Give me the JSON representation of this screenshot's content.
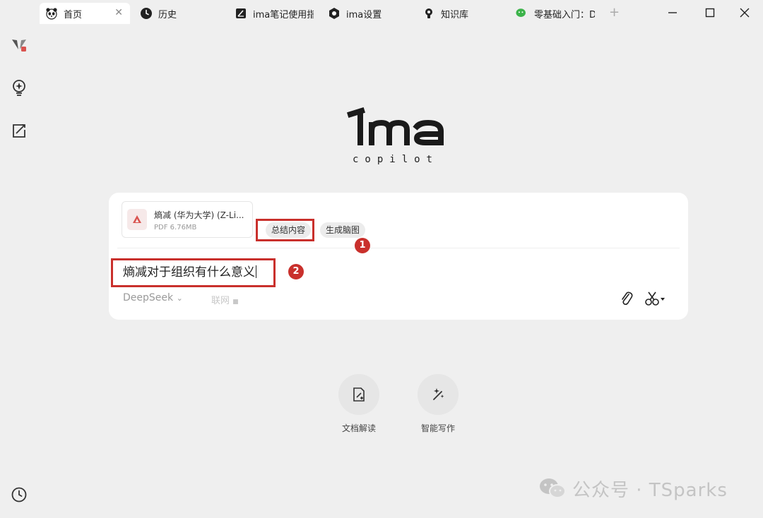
{
  "tabs": [
    {
      "label": "首页",
      "icon": "panda-icon"
    },
    {
      "label": "历史",
      "icon": "clock-icon"
    },
    {
      "label": "ima笔记使用指",
      "icon": "note-icon"
    },
    {
      "label": "ima设置",
      "icon": "hexagon-icon"
    },
    {
      "label": "知识库",
      "icon": "bulb-icon"
    },
    {
      "label": "零基础入门：D",
      "icon": "wechat-icon"
    }
  ],
  "logo": {
    "wordmark": "ima",
    "subtitle": "copilot"
  },
  "file": {
    "name": "熵减 (华为大学) (Z-Li...",
    "meta": "PDF 6.76MB"
  },
  "actions": {
    "summarize": "总结内容",
    "mindmap": "生成脑图"
  },
  "query": "熵减对于组织有什么意义",
  "model": {
    "name": "DeepSeek",
    "web": "联网"
  },
  "annotations": {
    "one": "1",
    "two": "2"
  },
  "quick_actions": [
    {
      "label": "文档解读"
    },
    {
      "label": "智能写作"
    }
  ],
  "watermark": "公众号 · TSparks",
  "colors": {
    "accent_red": "#c9302c",
    "background": "#efefef",
    "card": "#ffffff"
  }
}
